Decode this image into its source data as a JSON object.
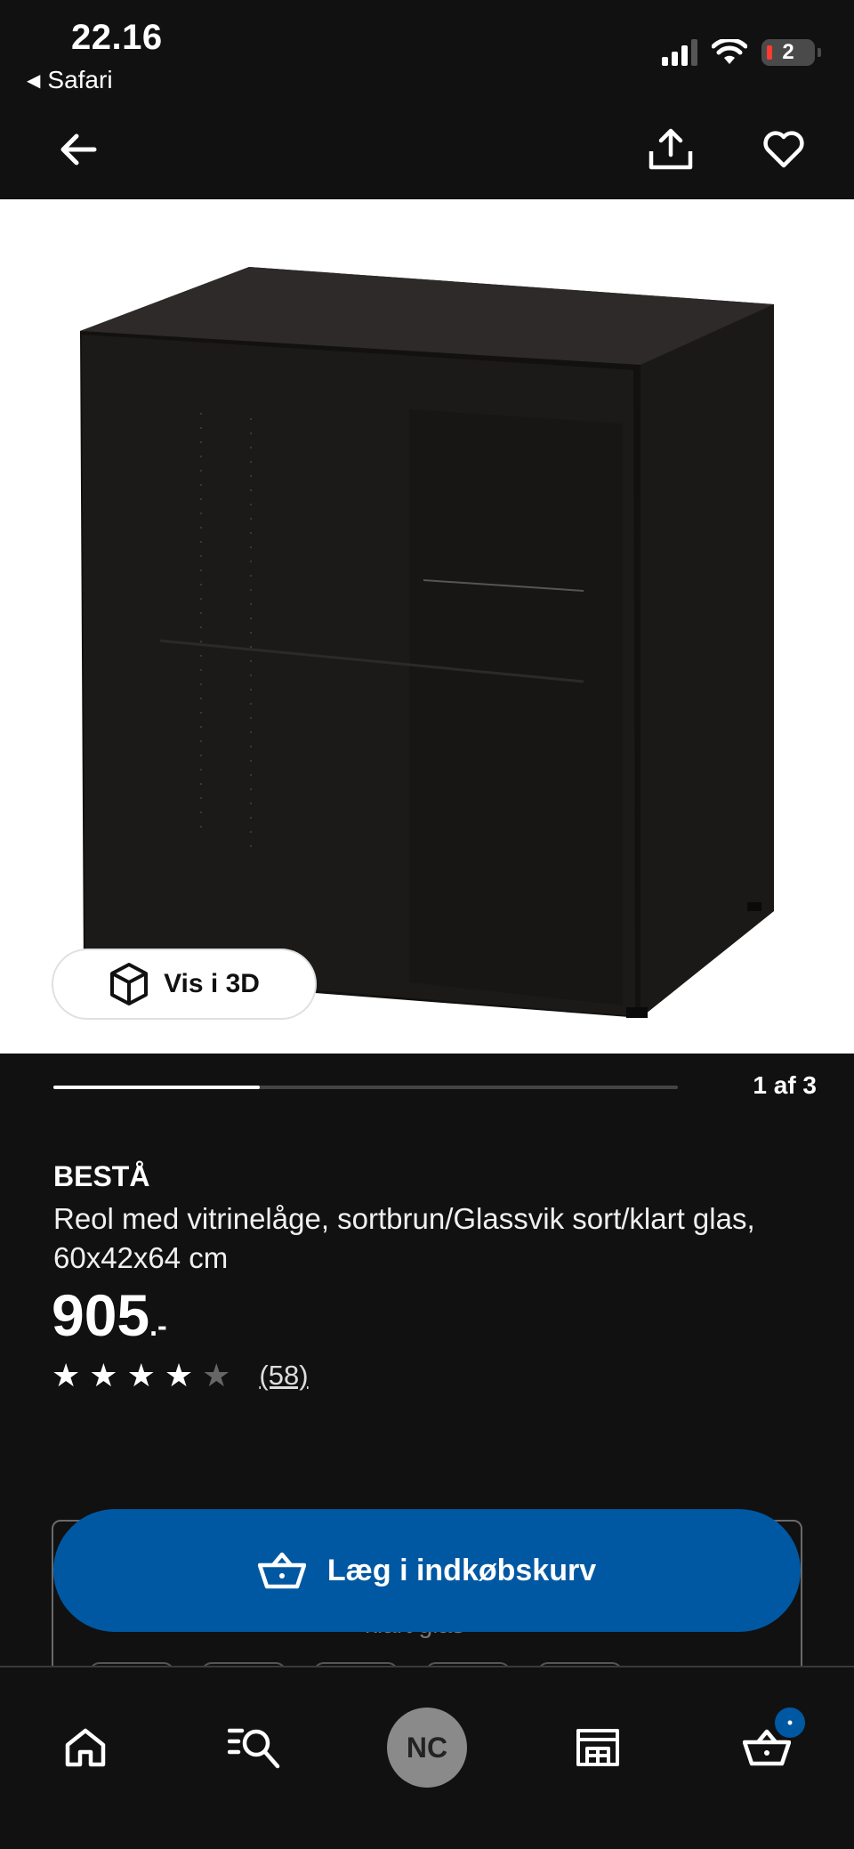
{
  "status_bar": {
    "time": "22.16",
    "back_app": "Safari",
    "battery_level": "2"
  },
  "app_bar": {
    "back_icon": "arrow-left-icon",
    "share_icon": "share-icon",
    "favorite_icon": "heart-icon"
  },
  "gallery": {
    "view_3d_label": "Vis i 3D",
    "counter": "1 af 3",
    "progress": 0.33
  },
  "product": {
    "brand": "BESTÅ",
    "description": "Reol med vitrinelåge, sortbrun/Glassvik sort/klart glas, 60x42x64 cm",
    "price": "905",
    "price_suffix": ".-",
    "rating": 4,
    "rating_max": 5,
    "review_count": "(58)"
  },
  "options": {
    "partial_text": "klart glas"
  },
  "cta": {
    "label": "Læg i indkøbskurv"
  },
  "bottom_nav": {
    "home_icon": "home-icon",
    "search_icon": "search-icon",
    "avatar_initials": "NC",
    "store_icon": "store-icon",
    "cart_icon": "basket-icon",
    "cart_badge": "•"
  },
  "colors": {
    "background": "#111111",
    "accent": "#0058a3"
  }
}
